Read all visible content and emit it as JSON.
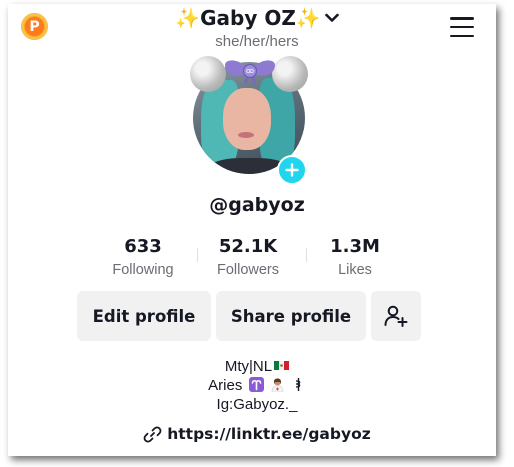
{
  "header": {
    "display_name": "✨Gaby OZ✨",
    "pronouns": "she/her/hers",
    "coin_icon_letter": "P"
  },
  "profile": {
    "username": "@gabyoz"
  },
  "stats": [
    {
      "value": "633",
      "label": "Following"
    },
    {
      "value": "52.1K",
      "label": "Followers"
    },
    {
      "value": "1.3M",
      "label": "Likes"
    }
  ],
  "actions": {
    "edit_label": "Edit profile",
    "share_label": "Share profile",
    "add_friend_icon": "add-person-icon"
  },
  "bio": {
    "line1": "Mty|NL",
    "line1_emoji": "mexico-flag",
    "line2": "Aries",
    "line2_emoji": [
      "aries-sign",
      "woman-health-worker",
      "medical-symbol"
    ],
    "line3": "Ig:Gabyoz._"
  },
  "link": {
    "url": "https://linktr.ee/gabyoz",
    "icon": "link-icon"
  },
  "colors": {
    "accent_teal": "#20d5ec",
    "coin_orange": "#f5a623",
    "button_bg": "#f1f1f2",
    "secondary_text": "#6b6d74",
    "bow_purple": "#8e7bd1"
  }
}
